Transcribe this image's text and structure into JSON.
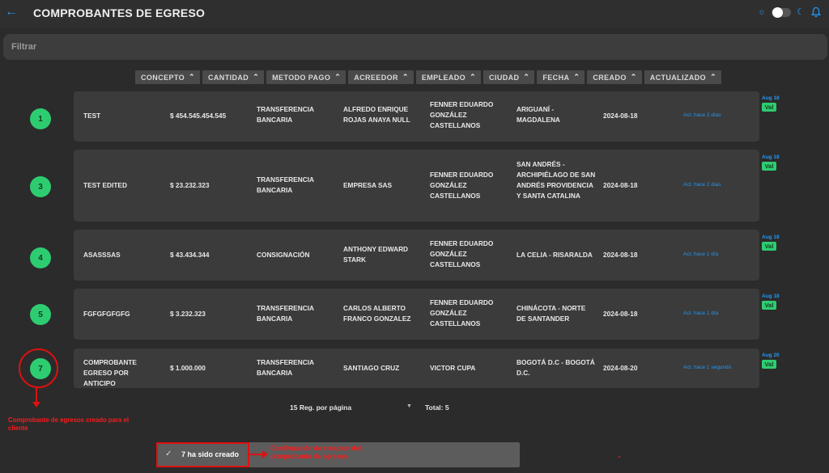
{
  "topbar": {
    "title": "COMPROBANTES DE EGRESO",
    "icons": [
      "back-arrow-icon",
      "sun-icon",
      "theme-toggle",
      "moon-icon",
      "bell-icon"
    ]
  },
  "filter": {
    "placeholder": "Filtrar",
    "value": ""
  },
  "columns": [
    "CONCEPTO",
    "CANTIDAD",
    "METODO PAGO",
    "ACREEDOR",
    "EMPLEADO",
    "CIUDAD",
    "FECHA",
    "CREADO",
    "ACTUALIZADO"
  ],
  "rows": [
    {
      "id": "1",
      "concepto": "TEST",
      "cantidad": "$ 454.545.454.545",
      "metodo": "TRANSFERENCIA BANCARIA",
      "acreedor": "ALFREDO ENRIQUE ROJAS ANAYA NULL",
      "empleado": "FENNER EDUARDO GONZÁLEZ CASTELLANOS",
      "ciudad": "ARIGUANÍ - MAGDALENA",
      "fecha": "2024-08-18",
      "actualizado": "Act. hace 2 días",
      "creado_fecha": "Aug 18",
      "creado_tag": "Val"
    },
    {
      "id": "3",
      "concepto": "TEST EDITED",
      "cantidad": "$ 23.232.323",
      "metodo": "TRANSFERENCIA BANCARIA",
      "acreedor": "EMPRESA SAS",
      "empleado": "FENNER EDUARDO GONZÁLEZ CASTELLANOS",
      "ciudad": "SAN ANDRÉS - ARCHIPIÉLAGO DE SAN ANDRÉS PROVIDENCIA Y SANTA CATALINA",
      "fecha": "2024-08-18",
      "actualizado": "Act. hace 2 días",
      "creado_fecha": "Aug 18",
      "creado_tag": "Val"
    },
    {
      "id": "4",
      "concepto": "ASASSSAS",
      "cantidad": "$ 43.434.344",
      "metodo": "CONSIGNACIÓN",
      "acreedor": "ANTHONY EDWARD STARK",
      "empleado": "FENNER EDUARDO GONZÁLEZ CASTELLANOS",
      "ciudad": "LA CELIA - RISARALDA",
      "fecha": "2024-08-18",
      "actualizado": "Act. hace 1 día",
      "creado_fecha": "Aug 18",
      "creado_tag": "Val"
    },
    {
      "id": "5",
      "concepto": "FGFGFGFGFG",
      "cantidad": "$ 3.232.323",
      "metodo": "TRANSFERENCIA BANCARIA",
      "acreedor": "CARLOS ALBERTO FRANCO GONZALEZ",
      "empleado": "FENNER EDUARDO GONZÁLEZ CASTELLANOS",
      "ciudad": "CHINÁCOTA - NORTE DE SANTANDER",
      "fecha": "2024-08-18",
      "actualizado": "Act. hace 1 día",
      "creado_fecha": "Aug 18",
      "creado_tag": "Val"
    },
    {
      "id": "7",
      "concepto": "COMPROBANTE EGRESO POR ANTICIPO",
      "cantidad": "$ 1.000.000",
      "metodo": "TRANSFERENCIA BANCARIA",
      "acreedor": "SANTIAGO CRUZ",
      "empleado": "VICTOR CUPA",
      "ciudad": "BOGOTÁ D.C - BOGOTÁ D.C.",
      "fecha": "2024-08-20",
      "actualizado": "Act. hace 1 segundo",
      "creado_fecha": "Aug 20",
      "creado_tag": "Val"
    }
  ],
  "pagination": {
    "per_page": "15 Reg. por página",
    "total": "Total: 5"
  },
  "toast": {
    "text": "7 ha sido creado"
  },
  "annotations": {
    "created": "Comprobante de egresos creado para el cliente",
    "confirmation": "Confirmación de creacion del comprobante de egresos"
  },
  "colors": {
    "accent": "#2196f3",
    "success": "#2ecc71",
    "annotation": "#e01010"
  }
}
